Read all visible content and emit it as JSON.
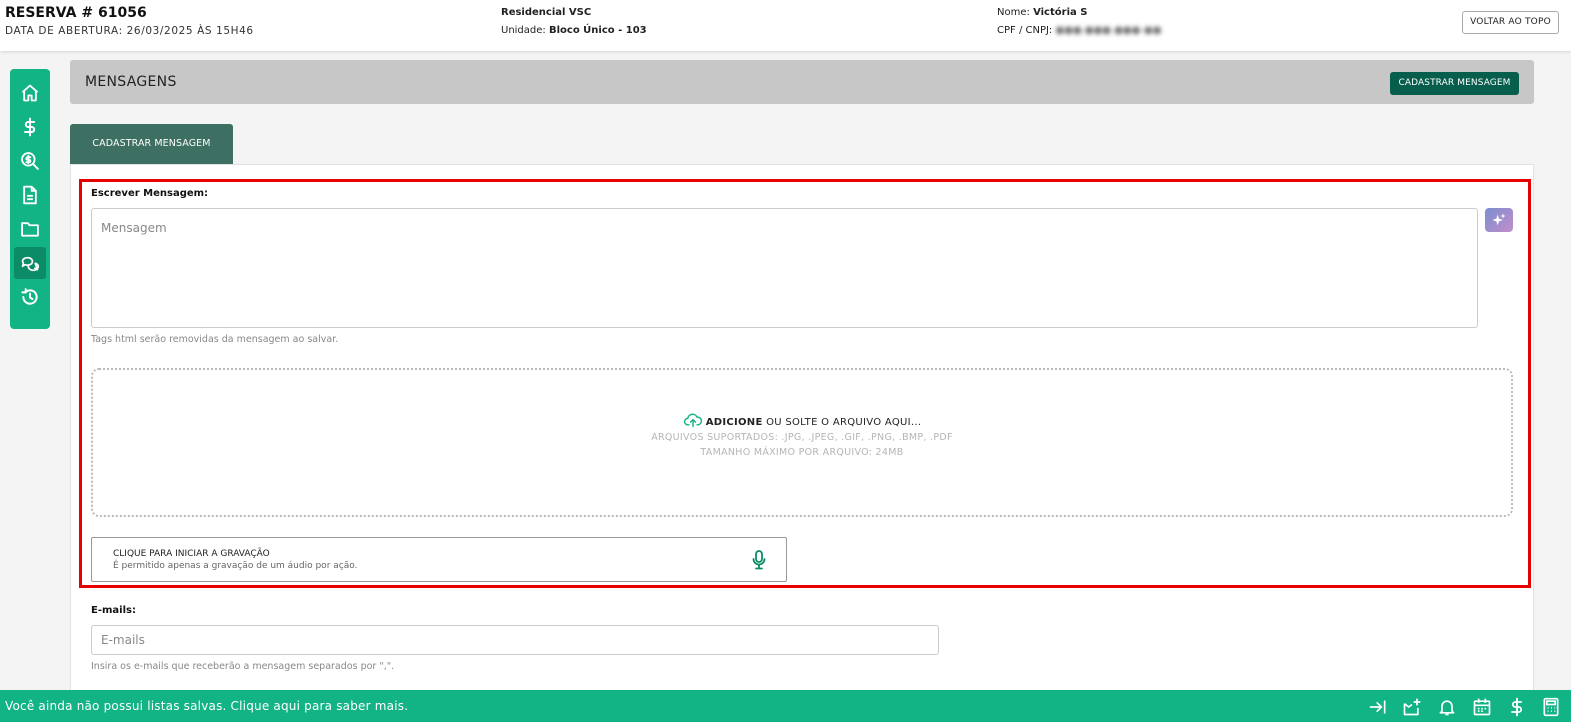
{
  "header": {
    "reservation_label": "RESERVA",
    "reservation_number": "# 61056",
    "opening_date": "DATA DE ABERTURA: 26/03/2025 ÀS 15H46",
    "property_name": "Residencial VSC",
    "unit_label": "Unidade:",
    "unit_value": "Bloco Único - 103",
    "client_label": "Nome:",
    "client_name": "Victória S",
    "doc_label": "CPF / CNPJ:",
    "doc_value": "●●●.●●●.●●●-●●",
    "back_to_top": "VOLTAR AO TOPO"
  },
  "sidebar": {
    "items": [
      {
        "icon": "home-icon",
        "active": false
      },
      {
        "icon": "dollar-icon",
        "active": false
      },
      {
        "icon": "search-dollar-icon",
        "active": false
      },
      {
        "icon": "document-icon",
        "active": false
      },
      {
        "icon": "folder-icon",
        "active": false
      },
      {
        "icon": "chat-icon",
        "active": true
      },
      {
        "icon": "history-icon",
        "active": false
      }
    ]
  },
  "messages": {
    "title": "MENSAGENS",
    "register_button": "CADASTRAR MENSAGEM",
    "tab_label": "CADASTRAR MENSAGEM",
    "write_label": "Escrever Mensagem:",
    "message_placeholder": "Mensagem",
    "html_hint": "Tags html serão removidas da mensagem ao salvar.",
    "dropzone": {
      "add": "ADICIONE",
      "rest": " OU SOLTE O ARQUIVO AQUI...",
      "supported": "ARQUIVOS SUPORTADOS: .JPG, .JPEG, .GIF, .PNG, .BMP, .PDF",
      "max_size": "TAMANHO MÁXIMO POR ARQUIVO: 24MB"
    },
    "recorder": {
      "title": "CLIQUE PARA INICIAR A GRAVAÇÃO",
      "subtitle": "É permitido apenas a gravação de um áudio por ação."
    },
    "emails_label": "E-mails:",
    "emails_placeholder": "E-mails",
    "emails_hint": "Insira os e-mails que receberão a mensagem separados por \",\"."
  },
  "bottom_bar": {
    "text": "Você ainda não possui listas salvas. Clique aqui para saber mais.",
    "icons": [
      "collapse-right-icon",
      "add-list-icon",
      "bell-icon",
      "calendar-icon",
      "dollar-icon",
      "calculator-icon"
    ]
  },
  "colors": {
    "accent": "#12b384",
    "dark_green": "#075e4d",
    "tab_green": "#3d6f62",
    "highlight_red": "#e60000"
  }
}
